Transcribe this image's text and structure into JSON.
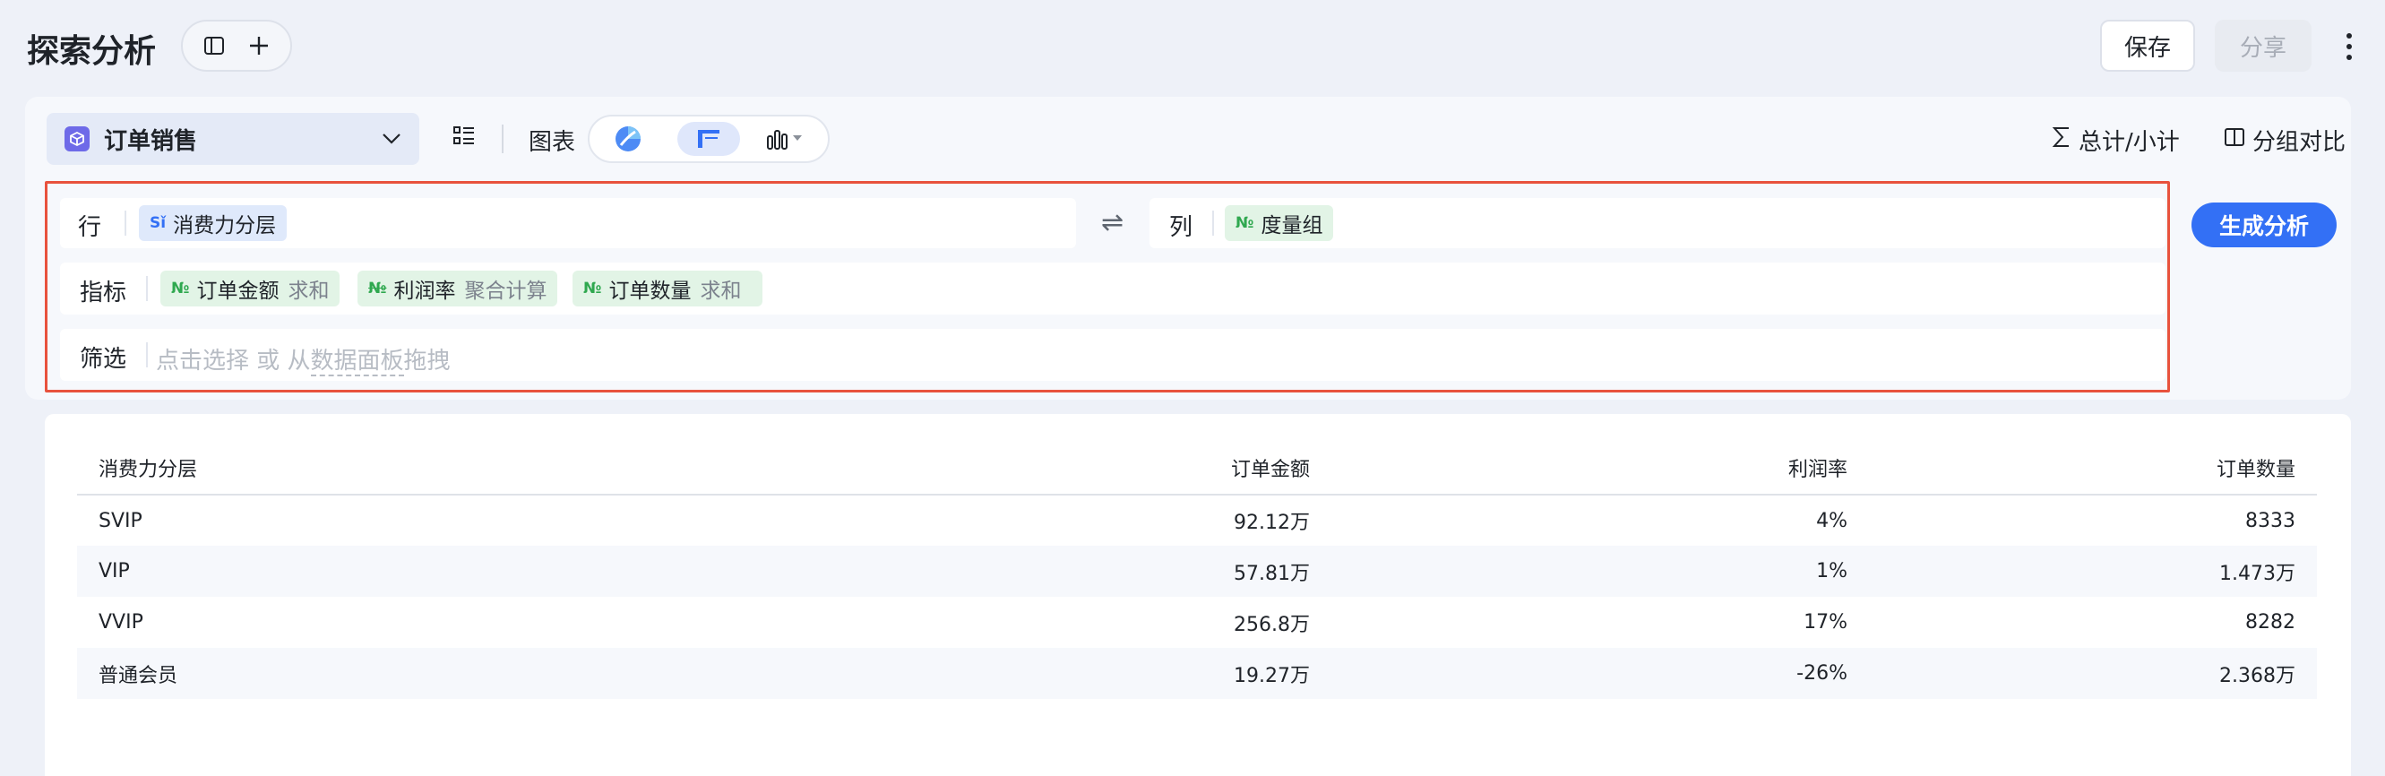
{
  "header": {
    "title": "探索分析",
    "save_label": "保存",
    "share_label": "分享"
  },
  "toolbar": {
    "dataset": "订单销售",
    "chart_label": "图表",
    "totals_label": "总计/小计",
    "compare_label": "分组对比"
  },
  "config": {
    "rows_label": "行",
    "rows": [
      {
        "type": "dimension",
        "label": "消费力分层"
      }
    ],
    "columns_label": "列",
    "columns": [
      {
        "type": "measure-group",
        "label": "度量组"
      }
    ],
    "measures_label": "指标",
    "measures": [
      {
        "label": "订单金额",
        "agg": "求和"
      },
      {
        "label": "利润率",
        "agg": "聚合计算"
      },
      {
        "label": "订单数量",
        "agg": "求和"
      }
    ],
    "filter_label": "筛选",
    "filter_placeholder_a": "点击选择 或 从",
    "filter_placeholder_link": "数据面板",
    "filter_placeholder_b": "拖拽",
    "generate_label": "生成分析"
  },
  "table": {
    "headers": [
      "消费力分层",
      "订单金额",
      "利润率",
      "订单数量"
    ],
    "rows": [
      [
        "SVIP",
        "92.12万",
        "4%",
        "8333"
      ],
      [
        "VIP",
        "57.81万",
        "1%",
        "1.473万"
      ],
      [
        "VVIP",
        "256.8万",
        "17%",
        "8282"
      ],
      [
        "普通会员",
        "19.27万",
        "-26%",
        "2.368万"
      ]
    ]
  },
  "colors": {
    "accent": "#3370f5",
    "highlight_border": "#e8523d",
    "dimension_chip": "#dfe9fb",
    "measure_chip": "#e2f4e6"
  },
  "icons": [
    "sidebar-toggle-icon",
    "plus-icon",
    "more-vertical-icon",
    "dataset-cube-icon",
    "chevron-down-icon",
    "list-icon",
    "smart-chart-icon",
    "table-chart-icon",
    "bar-chart-icon",
    "sigma-icon",
    "compare-icon",
    "swap-icon"
  ]
}
